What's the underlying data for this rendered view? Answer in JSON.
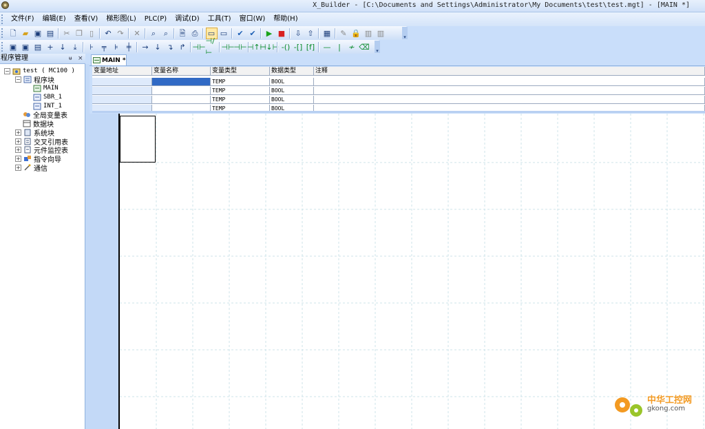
{
  "window": {
    "title": "X_Builder - [C:\\Documents and Settings\\Administrator\\My Documents\\test\\test.mgt] - [MAIN *]"
  },
  "menu": [
    "文件(F)",
    "编辑(E)",
    "查看(V)",
    "梯形图(L)",
    "PLC(P)",
    "调试(D)",
    "工具(T)",
    "窗口(W)",
    "帮助(H)"
  ],
  "panel": {
    "title": "程序管理",
    "pin_glyph": "ᵾ",
    "close_glyph": "×"
  },
  "tree": {
    "root": "test ( MC100 )",
    "program_blocks": "程序块",
    "main": "MAIN",
    "sbr": "SBR_1",
    "int": "INT_1",
    "global_vars": "全局变量表",
    "data_block": "数据块",
    "system_block": "系统块",
    "cross_ref": "交叉引用表",
    "monitor": "元件监控表",
    "wizard": "指令向导",
    "comm": "通信"
  },
  "tab": {
    "label": "MAIN *"
  },
  "var_table": {
    "headers": [
      "变量地址",
      "变量名称",
      "变量类型",
      "数据类型",
      "注释"
    ],
    "rows": [
      [
        "",
        "",
        "TEMP",
        "BOOL",
        ""
      ],
      [
        "",
        "",
        "TEMP",
        "BOOL",
        ""
      ],
      [
        "",
        "",
        "TEMP",
        "BOOL",
        ""
      ],
      [
        "",
        "",
        "TEMP",
        "BOOL",
        ""
      ]
    ]
  },
  "watermark": {
    "text": "中华工控网",
    "domain": "gkong.com"
  },
  "colors": {
    "chrome": "#c9defa",
    "selection": "#316ac5",
    "grid": "#cde3ea",
    "watermark": "#f39a22"
  }
}
